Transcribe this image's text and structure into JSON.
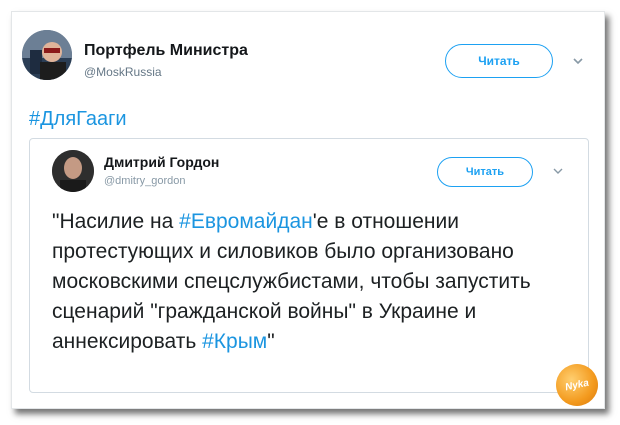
{
  "tweet": {
    "author_name": "Портфель Министра",
    "author_handle": "@MoskRussia",
    "follow_label": "Читать",
    "hashtag": "#ДляГааги"
  },
  "quoted_tweet": {
    "author_name": "Дмитрий Гордон",
    "author_handle": "@dmitry_gordon",
    "follow_label": "Читать",
    "text": {
      "part1": "\"Насилие на ",
      "tag1": "#Евромайдан",
      "part2": "'е в отношении протестующих и силовиков было организовано московскими спецслужбистами, чтобы запустить сценарий \"гражданской войны\" в Украине и аннексировать ",
      "tag2": "#Крым",
      "part3": "\""
    }
  },
  "watermark": {
    "text": "Nyka"
  },
  "colors": {
    "link_blue": "#1b95e0",
    "button_blue": "#1da1f2",
    "text_dark": "#14171a",
    "text_muted": "#657786"
  }
}
